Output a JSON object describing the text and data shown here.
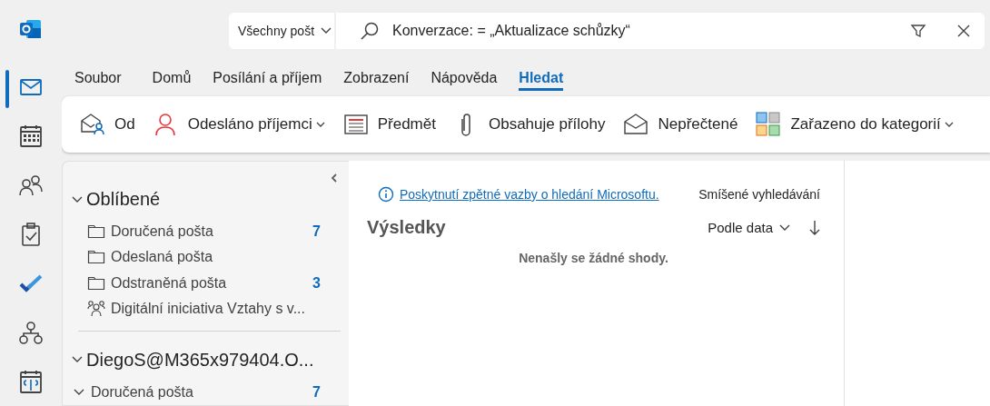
{
  "rail": [
    {
      "kind": "mail",
      "selected": true
    },
    {
      "kind": "calendar",
      "selected": false
    },
    {
      "kind": "people",
      "selected": false
    },
    {
      "kind": "tasks",
      "selected": false
    },
    {
      "kind": "todo",
      "selected": false
    },
    {
      "kind": "org",
      "selected": false
    },
    {
      "kind": "bookings",
      "selected": false
    }
  ],
  "scope": {
    "label": "Všechny pošt"
  },
  "search": {
    "value": "Konverzace: = „Aktualizace schůzky“"
  },
  "tabs": [
    {
      "label": "Soubor",
      "selected": false
    },
    {
      "label": "Domů",
      "selected": false
    },
    {
      "label": "Posílání a příjem",
      "selected": false
    },
    {
      "label": "Zobrazení",
      "selected": false
    },
    {
      "label": "Nápověda",
      "selected": false
    },
    {
      "label": "Hledat",
      "selected": true
    }
  ],
  "ribbon": [
    {
      "kind": "from",
      "label": "Od",
      "dropdown": false
    },
    {
      "kind": "sent-to",
      "label": "Odesláno příjemci",
      "dropdown": true
    },
    {
      "kind": "subject",
      "label": "Předmět",
      "dropdown": false
    },
    {
      "kind": "attachment",
      "label": "Obsahuje přílohy",
      "dropdown": false
    },
    {
      "kind": "unread",
      "label": "Nepřečtené",
      "dropdown": false
    },
    {
      "kind": "categorized",
      "label": "Zařazeno do kategorií",
      "dropdown": true
    }
  ],
  "folders": [
    {
      "title": "Oblíbené",
      "expanded": true,
      "children": [
        {
          "kind": "folder",
          "label": "Doručená pošta",
          "count": "7"
        },
        {
          "kind": "folder",
          "label": "Odeslaná pošta"
        },
        {
          "kind": "folder",
          "label": "Odstraněná pošta",
          "count": "3"
        },
        {
          "kind": "group",
          "label": "Digitální iniciativa Vztahy s v..."
        }
      ]
    },
    {
      "title": "DiegoS@M365x979404.O...",
      "expanded": true,
      "children": [
        {
          "label": "Doručená pošta",
          "count": "7",
          "expanded": true
        }
      ]
    }
  ],
  "results": {
    "feedback_link": "Poskytnutí zpětné vazby o hledání Microsoftu.",
    "mode": "Smíšené vyhledávání",
    "title": "Výsledky",
    "sort": "Podle data",
    "empty": "Nenašly se žádné shody."
  }
}
